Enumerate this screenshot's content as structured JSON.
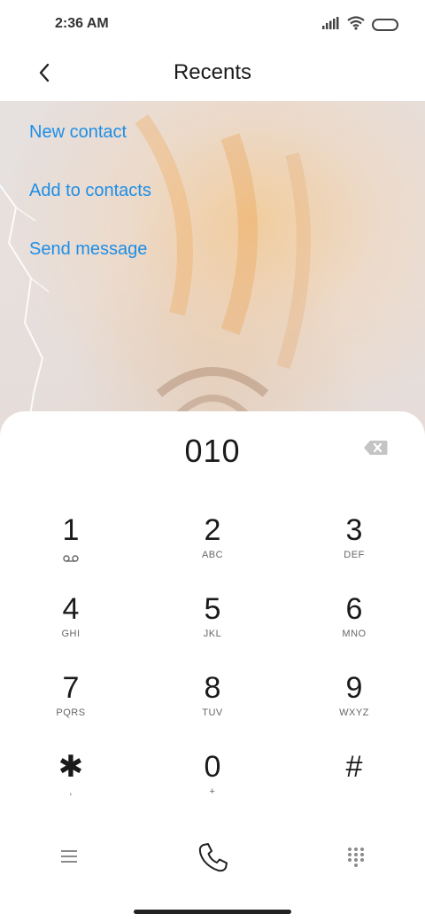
{
  "status_bar": {
    "time": "2:36 AM"
  },
  "header": {
    "title": "Recents"
  },
  "actions": {
    "new_contact": "New contact",
    "add_to_contacts": "Add to contacts",
    "send_message": "Send message"
  },
  "dialer": {
    "number": "010",
    "keys": [
      {
        "digit": "1",
        "letters": ""
      },
      {
        "digit": "2",
        "letters": "ABC"
      },
      {
        "digit": "3",
        "letters": "DEF"
      },
      {
        "digit": "4",
        "letters": "GHI"
      },
      {
        "digit": "5",
        "letters": "JKL"
      },
      {
        "digit": "6",
        "letters": "MNO"
      },
      {
        "digit": "7",
        "letters": "PQRS"
      },
      {
        "digit": "8",
        "letters": "TUV"
      },
      {
        "digit": "9",
        "letters": "WXYZ"
      },
      {
        "digit": "✱",
        "letters": ","
      },
      {
        "digit": "0",
        "letters": "+"
      },
      {
        "digit": "#",
        "letters": ""
      }
    ]
  },
  "icons": {
    "back": "chevron-left-icon",
    "signal": "signal-icon",
    "wifi": "wifi-icon",
    "battery": "battery-icon",
    "backspace": "backspace-icon",
    "voicemail": "voicemail-icon",
    "menu": "menu-icon",
    "call": "phone-icon",
    "keypad": "dialpad-icon"
  },
  "colors": {
    "accent": "#1e8ee6",
    "text": "#1a1a1a"
  }
}
